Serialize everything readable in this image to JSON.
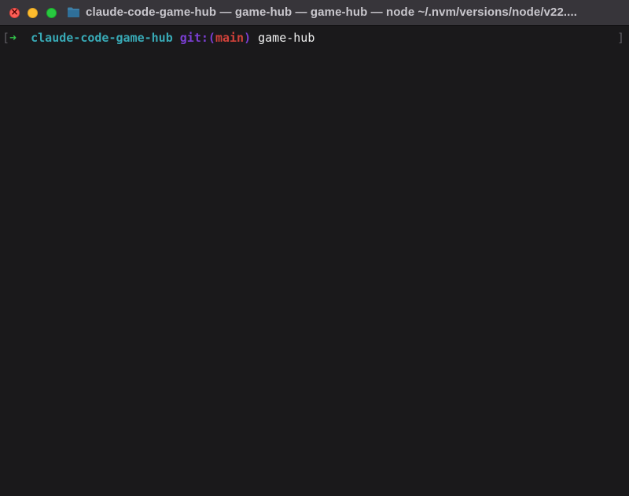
{
  "window": {
    "title": "claude-code-game-hub — game-hub — game-hub — node ~/.nvm/versions/node/v22...."
  },
  "icons": {
    "folder": "folder-icon",
    "close": "close-icon",
    "minimize": "minimize-icon",
    "zoom": "zoom-icon"
  },
  "prompt": {
    "left_bracket": "[",
    "arrow": "➜",
    "directory": "claude-code-game-hub",
    "git_label": "git:(",
    "branch": "main",
    "git_close": ")",
    "command": "game-hub",
    "right_bracket": "]"
  },
  "colors": {
    "close": "#fe5f57",
    "minimize": "#febc2e",
    "zoom": "#28c840",
    "arrow": "#32c24a",
    "directory": "#38a9b5",
    "git": "#7a3ed1",
    "branch": "#d2413a",
    "background": "#1a191b"
  }
}
